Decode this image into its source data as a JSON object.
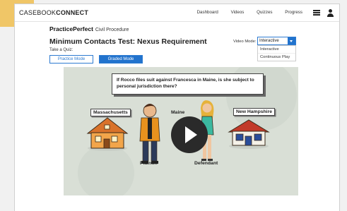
{
  "app": {
    "brand_light": "CASEBOOK",
    "brand_bold": "CONNECT"
  },
  "nav": {
    "items": [
      "Dashboard",
      "Videos",
      "Quizzes",
      "Progress"
    ]
  },
  "breadcrumb": {
    "product": "PracticePerfect",
    "course": "Civil Procedure"
  },
  "page": {
    "title": "Minimum Contacts Test: Nexus Requirement",
    "quiz_label": "Take a Quiz:"
  },
  "modes": {
    "practice": "Practice Mode",
    "graded": "Graded Mode"
  },
  "video_mode": {
    "label": "Video Mode:",
    "selected": "Interactive",
    "options": [
      "Interactive",
      "Continuous Play"
    ]
  },
  "video": {
    "question": "If Rocco files suit against Francesca in Maine, is she subject to personal jurisdiction there?",
    "labels": {
      "massachusetts": "Massachusetts",
      "maine": "Maine",
      "new_hampshire": "New Hampshire",
      "plaintiff": "Plaintiff",
      "defendant": "Defendant"
    }
  },
  "colors": {
    "accent": "#2273cd",
    "corner": "#f0c667",
    "video_bg": "#d7ddd5"
  },
  "icons": {
    "menu": "hamburger-menu-icon",
    "user": "user-icon",
    "play": "play-icon",
    "dropdown": "chevron-down-icon"
  }
}
